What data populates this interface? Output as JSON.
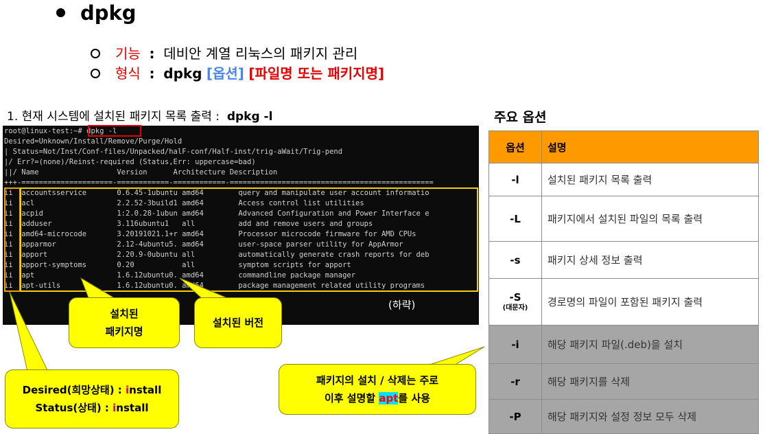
{
  "title": "dpkg",
  "function": {
    "label": "기능",
    "sep": ":",
    "text": "데비안 계열 리눅스의 패키지 관리"
  },
  "format": {
    "label": "형식",
    "sep": ":",
    "cmd": "dpkg",
    "opt": "[옵션]",
    "arg": "[파일명 또는 패키지명]"
  },
  "step": {
    "text": "1. 현재 시스템에 설치된 패키지 목록 출력 :",
    "cmd": "dpkg -l"
  },
  "terminal": {
    "prompt": "root@linux-test:~#",
    "command": "dpkg -l",
    "header": [
      "Desired=Unknown/Install/Remove/Purge/Hold",
      "| Status=Not/Inst/Conf-files/Unpacked/halF-conf/Half-inst/trig-aWait/Trig-pend",
      "|/ Err?=(none)/Reinst-required (Status,Err: uppercase=bad)",
      "||/ Name                  Version      Architecture Description",
      "+++-=====================-============-============-==============================================="
    ],
    "rows": [
      "ii  accountsservice       0.6.45-1ubuntu amd64        query and manipulate user account informatio",
      "ii  acl                   2.2.52-3build1 amd64        Access control list utilities",
      "ii  acpid                 1:2.0.28-1ubun amd64        Advanced Configuration and Power Interface e",
      "ii  adduser               3.116ubuntu1   all          add and remove users and groups",
      "ii  amd64-microcode       3.20191021.1+r amd64        Processor microcode firmware for AMD CPUs",
      "ii  apparmor              2.12-4ubuntu5. amd64        user-space parser utility for AppArmor",
      "ii  apport                2.20.9-0ubuntu all          automatically generate crash reports for deb",
      "ii  apport-symptoms       0.20           all          symptom scripts for apport",
      "ii  apt                   1.6.12ubuntu0. amd64        commandline package manager",
      "ii  apt-utils             1.6.12ubuntu0. amd64        package management related utility programs"
    ],
    "more": "(하략)"
  },
  "callouts": {
    "installed_name": [
      "설치된",
      "패키지명"
    ],
    "installed_version": "설치된 버전",
    "desired": {
      "label": "Desired(희망상태) : ",
      "i": "i",
      "rest": "nstall"
    },
    "status": {
      "label": "Status(상태) : ",
      "i": "i",
      "rest": "nstall"
    },
    "note_line1": "패키지의 설치 / 삭제는 주로",
    "note_pre": "이후 설명할 ",
    "note_apt": "apt",
    "note_post": "를 사용"
  },
  "options": {
    "title": "주요 옵션",
    "headers": [
      "옵션",
      "설명"
    ],
    "rows": [
      {
        "opt": "-l",
        "desc": "설치된 패키지 목록 출력"
      },
      {
        "opt": "-L",
        "desc": "패키지에서 설치된 파일의 목록 출력"
      },
      {
        "opt": "-s",
        "desc": "패키지 상세 정보 출력"
      },
      {
        "opt": "-S",
        "note": "(대문자)",
        "desc": "경로명의 파일이 포함된 패키지 출력"
      },
      {
        "opt": "-i",
        "desc": "해당 패키지 파일(.deb)을 설치"
      },
      {
        "opt": "-r",
        "desc": "해당 패키지를 삭제"
      },
      {
        "opt": "-P",
        "desc": "해당 패키지와 설정 정보 모두 삭제"
      }
    ]
  },
  "colors": {
    "accent": "#ff9900",
    "red": "#e60000",
    "blue": "#4a86e8",
    "callout": "#ffff00",
    "terminal_bg": "#0c0c0c"
  }
}
